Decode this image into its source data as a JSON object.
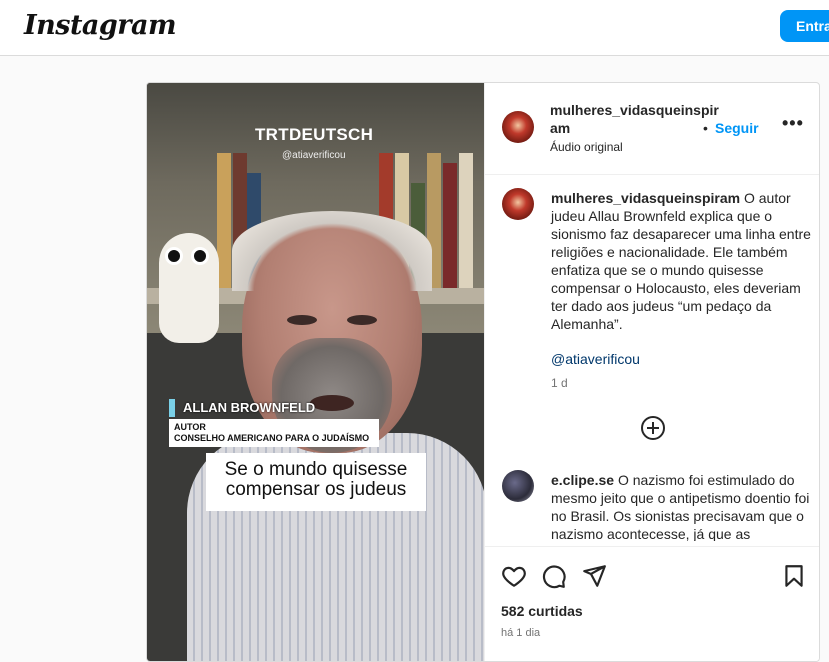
{
  "header": {
    "logo_text": "Instagram",
    "login_label": "Entrar"
  },
  "video": {
    "channel": "TRTDEUTSCH",
    "handle": "@atiaverificou",
    "name_tag": "ALLAN BROWNFELD",
    "role_line1": "AUTOR",
    "role_line2": "CONSELHO AMERICANO PARA O JUDAÍSMO",
    "subtitle_line1": "Se o mundo quisesse",
    "subtitle_line2": "compensar os judeus"
  },
  "post": {
    "username_line1": "mulheres_vidasqueinspir",
    "username_line2": "am",
    "follow_label": "Seguir",
    "dot": "•",
    "more_label": "•••",
    "audio_label": "Áudio original"
  },
  "caption": {
    "username": "mulheres_vidasqueinspiram",
    "text": "O autor judeu Allau Brownfeld explica que o sionismo faz desaparecer uma linha entre religiões e nacionalidade. Ele também enfatiza que se o mundo quisesse compensar o Holocausto, eles deveriam ter dado aos judeus “um pedaço da Alemanha”.",
    "mention": "@atiaverificou",
    "age": "1 d"
  },
  "comment": {
    "username": "e.clipe.se",
    "text": "O nazismo foi estimulado do mesmo jeito que o antipetismo doentio foi no Brasil. Os sionistas precisavam que o nazismo acontecesse, já que as"
  },
  "stats": {
    "likes": "582 curtidas",
    "time": "há 1 dia"
  },
  "icons": [
    "heart-icon",
    "comment-icon",
    "share-icon",
    "bookmark-icon",
    "add-comment-icon",
    "more-options-icon"
  ],
  "colors": {
    "accent": "#0095f6",
    "mention": "#00376b",
    "muted": "#737373",
    "name_tag_bar": "#7ad0e8"
  }
}
